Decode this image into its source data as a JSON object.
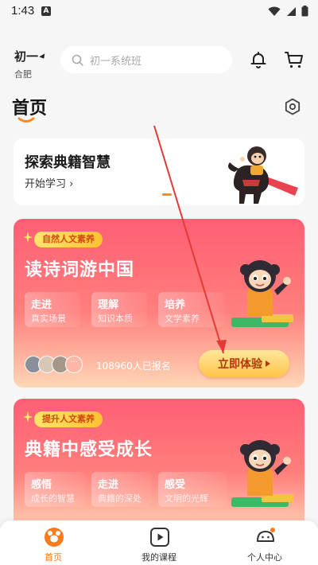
{
  "status_bar": {
    "time": "1:43",
    "notif_icon": "a-notification-icon"
  },
  "header": {
    "grade": "初一",
    "city": "合肥",
    "search_placeholder": "初一系统班"
  },
  "page": {
    "title": "首页"
  },
  "explore_card": {
    "title": "探索典籍智慧",
    "subtitle": "开始学习 ›"
  },
  "courses": [
    {
      "badge": "自然人文素养",
      "title": "读诗词游中国",
      "features": [
        {
          "head": "走进",
          "sub": "真实场景"
        },
        {
          "head": "理解",
          "sub": "知识本质"
        },
        {
          "head": "培养",
          "sub": "文学素养"
        }
      ],
      "signup": "108960人已报名",
      "cta": "立即体验"
    },
    {
      "badge": "提升人文素养",
      "title": "典籍中感受成长",
      "features": [
        {
          "head": "感悟",
          "sub": "成长的智慧"
        },
        {
          "head": "走进",
          "sub": "典籍的深处"
        },
        {
          "head": "感受",
          "sub": "文明的光辉"
        }
      ]
    }
  ],
  "bottom_nav": [
    {
      "label": "首页",
      "icon": "home-icon",
      "active": true
    },
    {
      "label": "我的课程",
      "icon": "play-icon",
      "active": false
    },
    {
      "label": "个人中心",
      "icon": "profile-icon",
      "active": false
    }
  ],
  "colors": {
    "accent": "#ff7a1a",
    "card_red": "#ff5e74",
    "cta_gold": "#ffc54a"
  }
}
